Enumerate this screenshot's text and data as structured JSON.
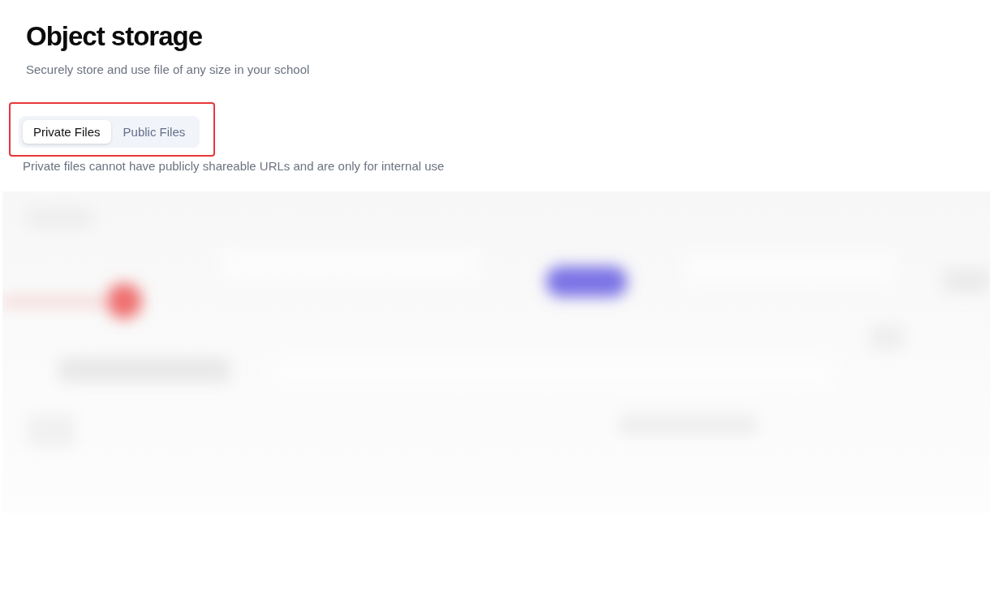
{
  "title": "Object storage",
  "subtitle": "Securely store and use file of any size in your school",
  "tabs": [
    {
      "label": "Private Files",
      "selected": true
    },
    {
      "label": "Public Files",
      "selected": false
    }
  ],
  "tab_note": "Private files cannot have publicly shareable URLs and are only for internal use"
}
